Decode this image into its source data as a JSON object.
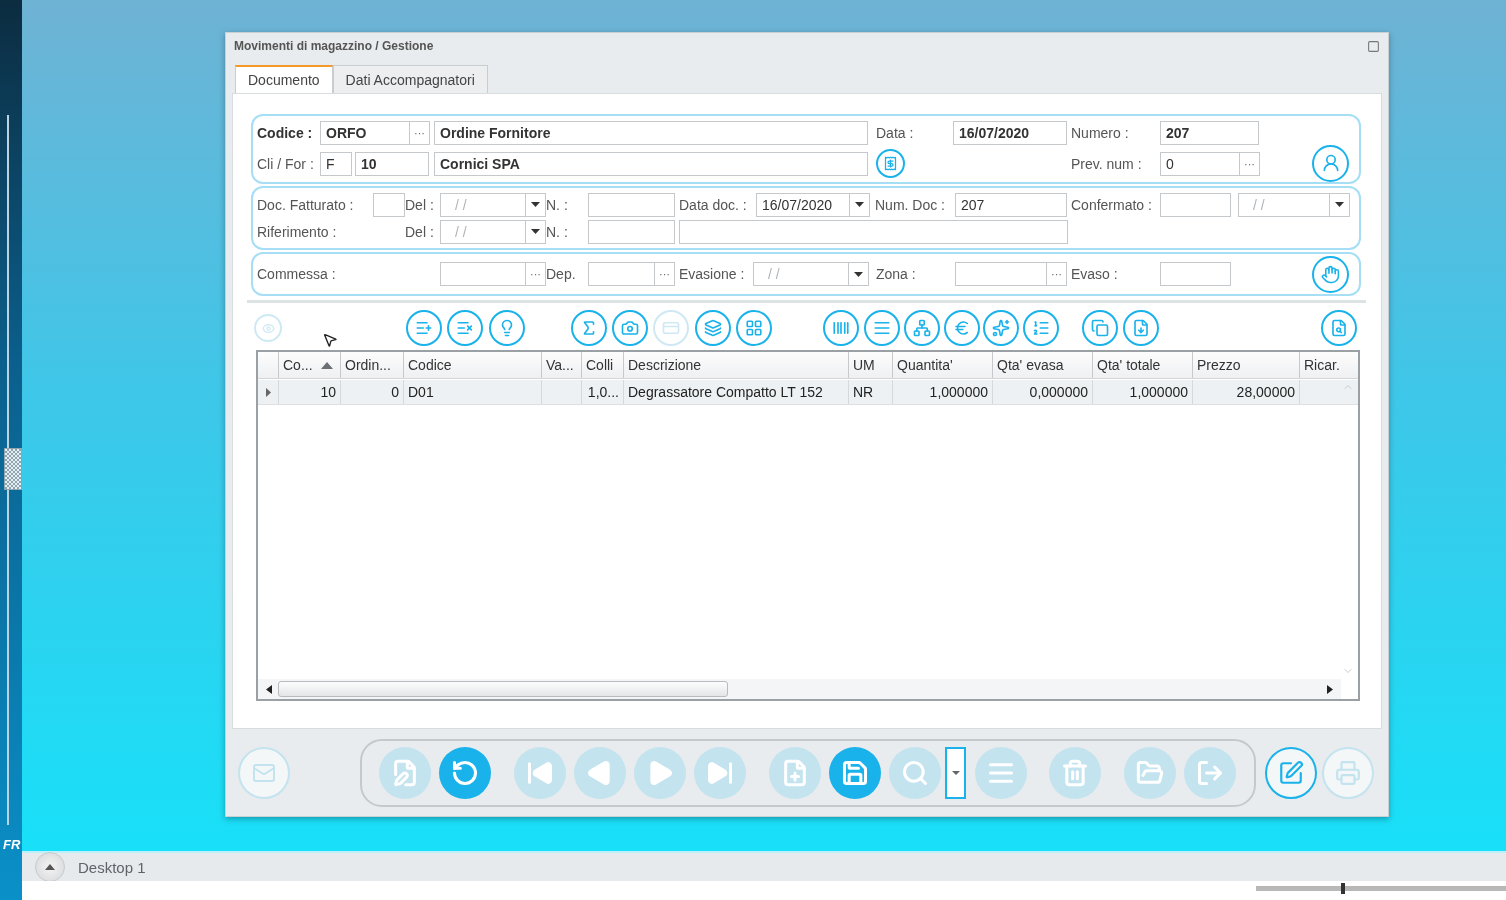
{
  "window": {
    "title": "Movimenti di magazzino / Gestione"
  },
  "tabs": [
    {
      "label": "Documento",
      "selected": true
    },
    {
      "label": "Dati Accompagnatori",
      "selected": false
    }
  ],
  "header": {
    "codice_label": "Codice :",
    "codice": "ORFO",
    "codice_desc": "Ordine Fornitore",
    "data_label": "Data :",
    "data": "16/07/2020",
    "numero_label": "Numero :",
    "numero": "207",
    "clifor_label": "Cli / For :",
    "clifor_type": "F",
    "clifor_code": "10",
    "clifor_name": "Cornici SPA",
    "prev_num_label": "Prev. num :",
    "prev_num": "0"
  },
  "document": {
    "doc_fatturato_label": "Doc. Fatturato :",
    "del_label_1": "Del :",
    "del_placeholder_1": "/ /",
    "n_label_1": "N. :",
    "data_doc_label": "Data doc. :",
    "data_doc": "16/07/2020",
    "num_doc_label": "Num. Doc :",
    "num_doc": "207",
    "confermato_label": "Confermato :",
    "confermato_placeholder": "/ /",
    "riferimento_label": "Riferimento :",
    "del_label_2": "Del :",
    "del_placeholder_2": "/ /",
    "n_label_2": "N. :"
  },
  "extra": {
    "commessa_label": "Commessa :",
    "dep_label": "Dep.",
    "evasione_label": "Evasione :",
    "evasione_placeholder": "/ /",
    "zona_label": "Zona :",
    "evaso_label": "Evaso :"
  },
  "lookup_button": "···",
  "toolbar": [
    {
      "disabled": true
    },
    {
      "disabled": false
    },
    {
      "disabled": false
    },
    {
      "disabled": false
    },
    {
      "disabled": false
    },
    {
      "disabled": false
    },
    {
      "disabled": true
    },
    {
      "disabled": false
    },
    {
      "disabled": false
    },
    {
      "disabled": false
    },
    {
      "disabled": false
    },
    {
      "disabled": false
    },
    {
      "disabled": false
    },
    {
      "disabled": false
    },
    {
      "disabled": false
    },
    {
      "disabled": false
    },
    {
      "disabled": false
    },
    {
      "disabled": false
    }
  ],
  "table": {
    "columns": [
      {
        "label": "Co...",
        "sorted": true
      },
      {
        "label": "Ordin...",
        "sorted": false
      },
      {
        "label": "Codice",
        "sorted": false
      },
      {
        "label": "Va...",
        "sorted": false
      },
      {
        "label": "Colli",
        "sorted": false
      },
      {
        "label": "Descrizione",
        "sorted": false
      },
      {
        "label": "UM",
        "sorted": false
      },
      {
        "label": "Quantita'",
        "sorted": false
      },
      {
        "label": "Qta' evasa",
        "sorted": false
      },
      {
        "label": "Qta' totale",
        "sorted": false
      },
      {
        "label": "Prezzo",
        "sorted": false
      },
      {
        "label": "Ricar.",
        "sorted": false
      }
    ],
    "rows": [
      {
        "current": true,
        "cells": [
          "10",
          "0",
          "D01",
          null,
          "1,0...",
          "Degrassatore Compatto LT 152",
          "NR",
          "1,000000",
          "0,000000",
          "1,000000",
          "28,00000",
          null
        ]
      }
    ]
  },
  "bottom_left": [
    {
      "disabled": true
    }
  ],
  "navigator": [
    {
      "kind": "button",
      "disabled": true
    },
    {
      "kind": "button",
      "disabled": false
    },
    {
      "kind": "button",
      "disabled": true
    },
    {
      "kind": "button",
      "disabled": true
    },
    {
      "kind": "button",
      "disabled": true
    },
    {
      "kind": "button",
      "disabled": true
    },
    {
      "kind": "button",
      "disabled": true
    },
    {
      "kind": "button",
      "disabled": false
    },
    {
      "kind": "button",
      "disabled": true
    },
    {
      "kind": "dropdown",
      "disabled": false
    },
    {
      "kind": "button",
      "disabled": true
    },
    {
      "kind": "button",
      "disabled": true
    },
    {
      "kind": "button",
      "disabled": true
    },
    {
      "kind": "button",
      "disabled": true
    }
  ],
  "bottom_right": [
    {
      "disabled": false
    },
    {
      "disabled": true
    }
  ],
  "sidebar": {
    "label": "FR"
  },
  "taskbar": {
    "desktop": "Desktop 1"
  },
  "zoom": {
    "level": 0.34
  }
}
